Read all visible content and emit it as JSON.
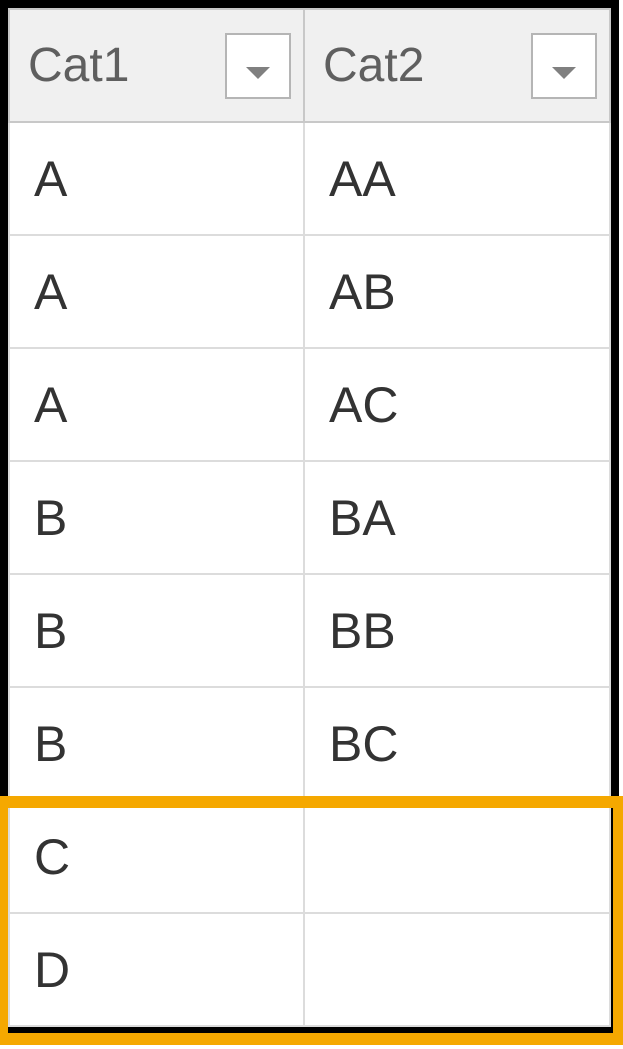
{
  "table": {
    "headers": {
      "col1": "Cat1",
      "col2": "Cat2"
    },
    "rows": [
      {
        "col1": "A",
        "col2": "AA"
      },
      {
        "col1": "A",
        "col2": "AB"
      },
      {
        "col1": "A",
        "col2": "AC"
      },
      {
        "col1": "B",
        "col2": "BA"
      },
      {
        "col1": "B",
        "col2": "BB"
      },
      {
        "col1": "B",
        "col2": "BC"
      },
      {
        "col1": "C",
        "col2": ""
      },
      {
        "col1": "D",
        "col2": ""
      }
    ]
  }
}
